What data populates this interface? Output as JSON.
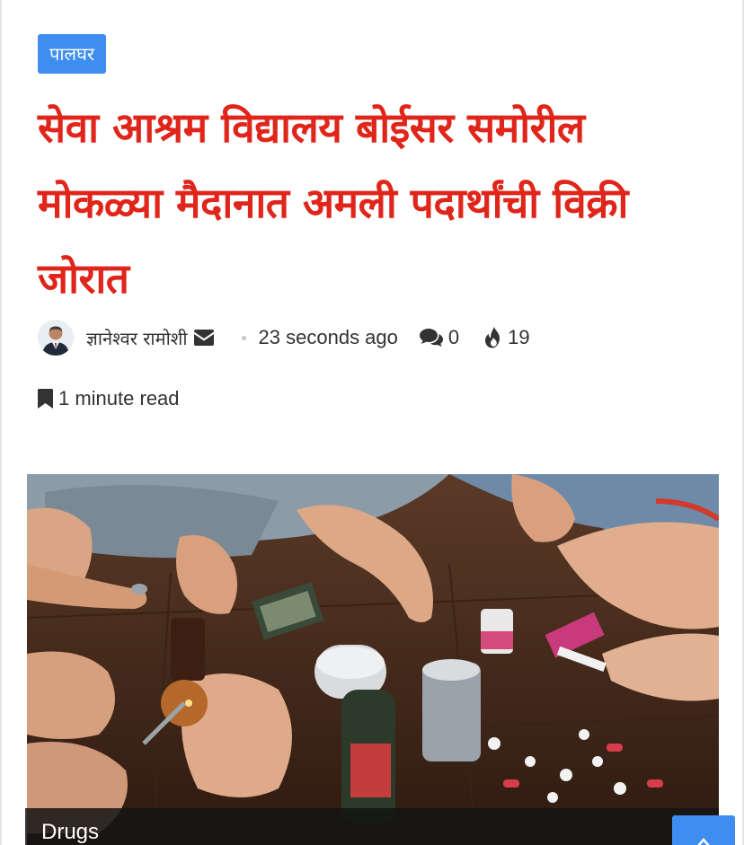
{
  "article": {
    "category": "पालघर",
    "title": "सेवा आश्रम विद्यालय बोईसर समोरील मोकळ्या मैदानात अमली पदार्थांची विक्री जोरात",
    "author": "ज्ञानेश्वर रामोशी",
    "time_ago": "23 seconds ago",
    "comments": "0",
    "views": "19",
    "read_time": "1 minute read",
    "image_caption": "Drugs"
  },
  "icons": {
    "author": "avatar",
    "email": "envelope-icon",
    "comments": "comments-icon",
    "views": "fire-icon",
    "read_time": "bookmark-icon",
    "scroll": "chevron-up-icon"
  },
  "colors": {
    "accent": "#3d8ef0",
    "title": "#e0251b",
    "meta_text": "#333333"
  }
}
